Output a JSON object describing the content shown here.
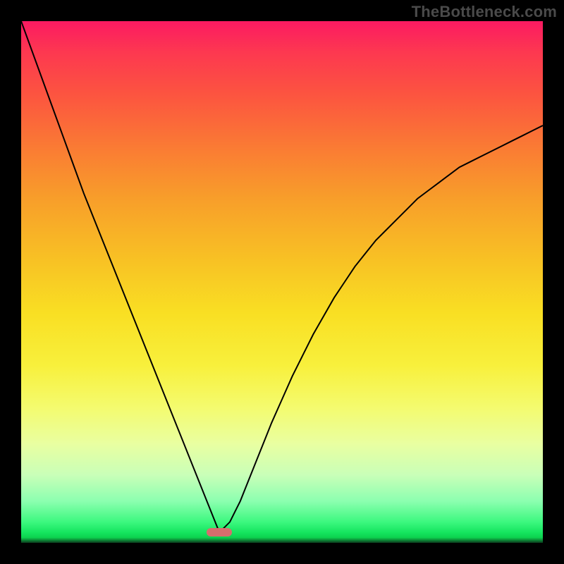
{
  "watermark": "TheBottleneck.com",
  "chart_data": {
    "type": "line",
    "title": "",
    "xlabel": "",
    "ylabel": "",
    "xlim": [
      0,
      100
    ],
    "ylim": [
      0,
      100
    ],
    "grid": false,
    "legend": false,
    "annotations": [
      {
        "name": "min-match-marker",
        "x": 38,
        "y": 2
      }
    ],
    "series": [
      {
        "name": "bottleneck-curve",
        "x": [
          0,
          4,
          8,
          12,
          16,
          20,
          24,
          28,
          32,
          34,
          36,
          38,
          40,
          42,
          44,
          48,
          52,
          56,
          60,
          64,
          68,
          72,
          76,
          80,
          84,
          88,
          92,
          96,
          100
        ],
        "y": [
          100,
          89,
          78,
          67,
          57,
          47,
          37,
          27,
          17,
          12,
          7,
          2,
          4,
          8,
          13,
          23,
          32,
          40,
          47,
          53,
          58,
          62,
          66,
          69,
          72,
          74,
          76,
          78,
          80
        ]
      }
    ],
    "background_gradient": {
      "orientation": "vertical",
      "stops": [
        {
          "pos": 0.0,
          "color": "#fb1a62"
        },
        {
          "pos": 0.14,
          "color": "#fc5440"
        },
        {
          "pos": 0.34,
          "color": "#f89e2a"
        },
        {
          "pos": 0.56,
          "color": "#f9df23"
        },
        {
          "pos": 0.74,
          "color": "#f4fb6e"
        },
        {
          "pos": 0.92,
          "color": "#8cffb0"
        },
        {
          "pos": 0.99,
          "color": "#0dd14e"
        },
        {
          "pos": 1.0,
          "color": "#0c3a1c"
        }
      ]
    }
  }
}
